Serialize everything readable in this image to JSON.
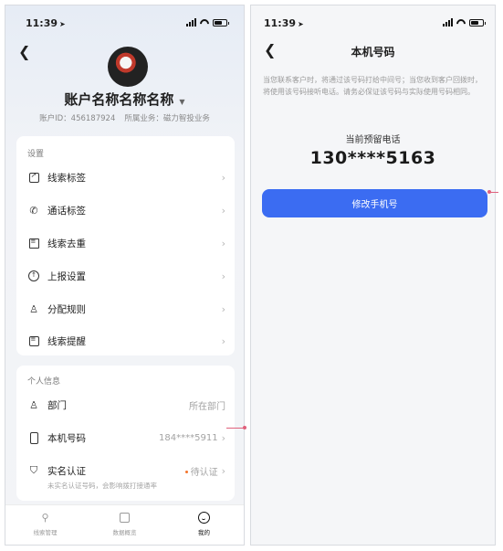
{
  "left": {
    "status": {
      "time": "11:39"
    },
    "account": {
      "name": "账户名称名称名称",
      "id_text": "账户ID：456187924",
      "business_text": "所属业务：磁力智投业务"
    },
    "settings": {
      "title": "设置",
      "items": [
        {
          "label": "线索标签",
          "icon": "tag-icon"
        },
        {
          "label": "通话标签",
          "icon": "phone-call-icon"
        },
        {
          "label": "线索去重",
          "icon": "dedupe-icon"
        },
        {
          "label": "上报设置",
          "icon": "upload-icon"
        },
        {
          "label": "分配规则",
          "icon": "assign-user-icon"
        },
        {
          "label": "线索提醒",
          "icon": "message-icon"
        }
      ]
    },
    "personal": {
      "title": "个人信息",
      "department": {
        "label": "部门",
        "value": "所在部门"
      },
      "phone": {
        "label": "本机号码",
        "value": "184****5911"
      },
      "realname": {
        "label": "实名认证",
        "value": "待认证",
        "note": "未实名认证号码，会影响拨打接通率"
      }
    },
    "tabbar": [
      {
        "label": "线索管理",
        "icon": "lead-icon",
        "active": false
      },
      {
        "label": "数据概览",
        "icon": "data-icon",
        "active": false
      },
      {
        "label": "我的",
        "icon": "profile-smile-icon",
        "active": true
      }
    ]
  },
  "right": {
    "status": {
      "time": "11:39"
    },
    "title": "本机号码",
    "notice": "当您联系客户时，将通过该号码打给中间号；当您收到客户回拨时，将使用该号码接听电话。请务必保证该号码与实际使用号码相同。",
    "current_label": "当前预留电话",
    "current_number": "130****5163",
    "button_label": "修改手机号"
  },
  "colors": {
    "primary": "#3b6cf2",
    "pointer": "#e0617c",
    "pending": "#f3742b"
  }
}
